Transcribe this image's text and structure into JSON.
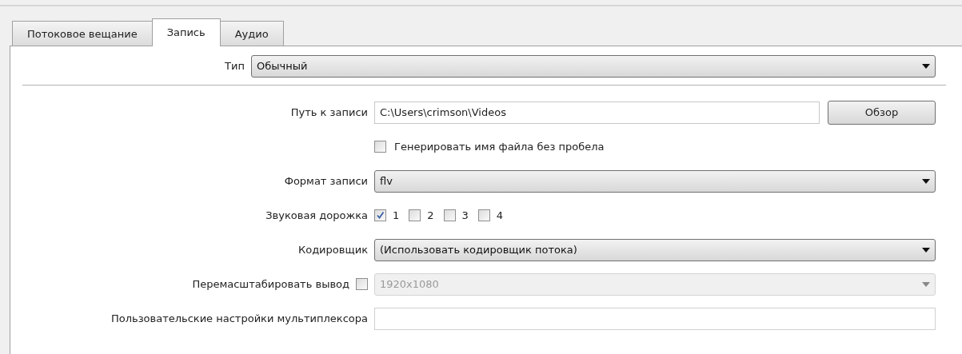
{
  "tabs": [
    {
      "label": "Потоковое вещание",
      "selected": false
    },
    {
      "label": "Запись",
      "selected": true
    },
    {
      "label": "Аудио",
      "selected": false
    }
  ],
  "type_row": {
    "label": "Тип",
    "value": "Обычный"
  },
  "rows": [
    {
      "kind": "path",
      "label": "Путь к записи",
      "value": "C:\\Users\\crimson\\Videos",
      "button": "Обзор"
    },
    {
      "kind": "checkbox",
      "text": "Генерировать имя файла без пробела",
      "checked": false
    },
    {
      "kind": "select",
      "label": "Формат записи",
      "value": "flv",
      "disabled": false
    },
    {
      "kind": "tracks",
      "label": "Звуковая дорожка",
      "tracks": [
        {
          "label": "1",
          "checked": true
        },
        {
          "label": "2",
          "checked": false
        },
        {
          "label": "3",
          "checked": false
        },
        {
          "label": "4",
          "checked": false
        }
      ]
    },
    {
      "kind": "select",
      "label": "Кодировщик",
      "value": "(Использовать кодировщик потока)",
      "disabled": false
    },
    {
      "kind": "rescale",
      "label": "Перемасштабировать вывод",
      "checked": false,
      "value": "1920x1080",
      "disabled": true
    },
    {
      "kind": "text",
      "label": "Пользовательские настройки мультиплексора"
    }
  ]
}
